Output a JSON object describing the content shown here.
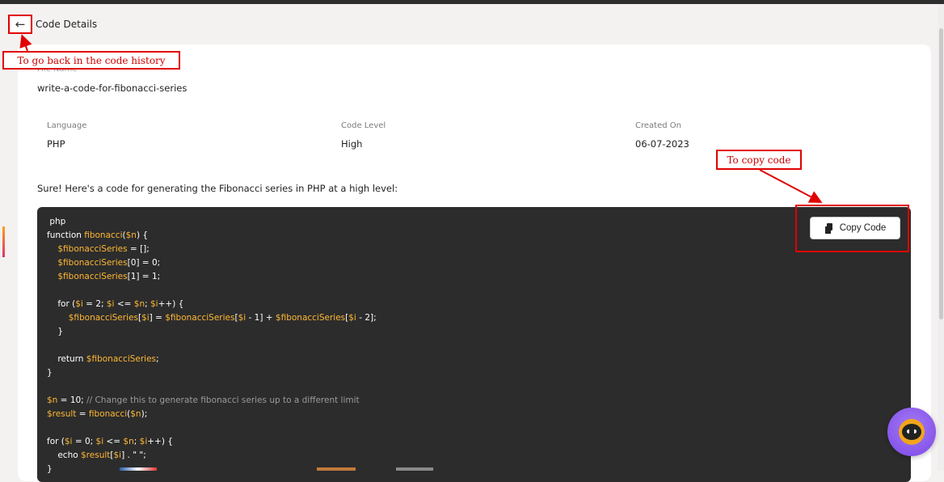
{
  "header": {
    "back_icon": "←",
    "title": "Code Details"
  },
  "file": {
    "label": "File Name",
    "value": "write-a-code-for-fibonacci-series"
  },
  "meta": [
    {
      "label": "Language",
      "value": "PHP"
    },
    {
      "label": "Code Level",
      "value": "High"
    },
    {
      "label": "Created On",
      "value": "06-07-2023"
    }
  ],
  "intro": "Sure! Here's a code for generating the Fibonacci series in PHP at a high level:",
  "copy_button": {
    "label": "Copy Code",
    "icon": "copy-icon"
  },
  "annotations": {
    "back": "To go back in the code history",
    "copy": "To copy code"
  },
  "colors": {
    "annotation": "#e00000",
    "code_background": "#2c2c2c",
    "code_variable": "#ffb833",
    "assistant": "#7b48e6"
  },
  "code_lines": [
    [
      {
        "t": " php"
      }
    ],
    [
      {
        "t": "function "
      },
      {
        "t": "fibonacci",
        "v": 1
      },
      {
        "t": "("
      },
      {
        "t": "$n",
        "v": 1
      },
      {
        "t": ") {"
      }
    ],
    [
      {
        "t": "    "
      },
      {
        "t": "$fibonacciSeries",
        "v": 1
      },
      {
        "t": " = [];"
      }
    ],
    [
      {
        "t": "    "
      },
      {
        "t": "$fibonacciSeries",
        "v": 1
      },
      {
        "t": "[0] = 0;"
      }
    ],
    [
      {
        "t": "    "
      },
      {
        "t": "$fibonacciSeries",
        "v": 1
      },
      {
        "t": "[1] = 1;"
      }
    ],
    [
      {
        "t": ""
      }
    ],
    [
      {
        "t": "    for ("
      },
      {
        "t": "$i",
        "v": 1
      },
      {
        "t": " = 2; "
      },
      {
        "t": "$i",
        "v": 1
      },
      {
        "t": " <= "
      },
      {
        "t": "$n",
        "v": 1
      },
      {
        "t": "; "
      },
      {
        "t": "$i",
        "v": 1
      },
      {
        "t": "++) {"
      }
    ],
    [
      {
        "t": "        "
      },
      {
        "t": "$fibonacciSeries",
        "v": 1
      },
      {
        "t": "["
      },
      {
        "t": "$i",
        "v": 1
      },
      {
        "t": "] = "
      },
      {
        "t": "$fibonacciSeries",
        "v": 1
      },
      {
        "t": "["
      },
      {
        "t": "$i",
        "v": 1
      },
      {
        "t": " - 1] + "
      },
      {
        "t": "$fibonacciSeries",
        "v": 1
      },
      {
        "t": "["
      },
      {
        "t": "$i",
        "v": 1
      },
      {
        "t": " - 2];"
      }
    ],
    [
      {
        "t": "    }"
      }
    ],
    [
      {
        "t": ""
      }
    ],
    [
      {
        "t": "    return "
      },
      {
        "t": "$fibonacciSeries",
        "v": 1
      },
      {
        "t": ";"
      }
    ],
    [
      {
        "t": "}"
      }
    ],
    [
      {
        "t": ""
      }
    ],
    [
      {
        "t": "$n",
        "v": 1
      },
      {
        "t": " = 10; "
      },
      {
        "t": "// Change this to generate fibonacci series up to a different limit",
        "c": 1
      }
    ],
    [
      {
        "t": "$result",
        "v": 1
      },
      {
        "t": " = "
      },
      {
        "t": "fibonacci",
        "v": 1
      },
      {
        "t": "("
      },
      {
        "t": "$n",
        "v": 1
      },
      {
        "t": ");"
      }
    ],
    [
      {
        "t": ""
      }
    ],
    [
      {
        "t": "for ("
      },
      {
        "t": "$i",
        "v": 1
      },
      {
        "t": " = 0; "
      },
      {
        "t": "$i",
        "v": 1
      },
      {
        "t": " <= "
      },
      {
        "t": "$n",
        "v": 1
      },
      {
        "t": "; "
      },
      {
        "t": "$i",
        "v": 1
      },
      {
        "t": "++) {"
      }
    ],
    [
      {
        "t": "    echo "
      },
      {
        "t": "$result",
        "v": 1
      },
      {
        "t": "["
      },
      {
        "t": "$i",
        "v": 1
      },
      {
        "t": "] . \" \";"
      }
    ],
    [
      {
        "t": "}"
      }
    ]
  ]
}
